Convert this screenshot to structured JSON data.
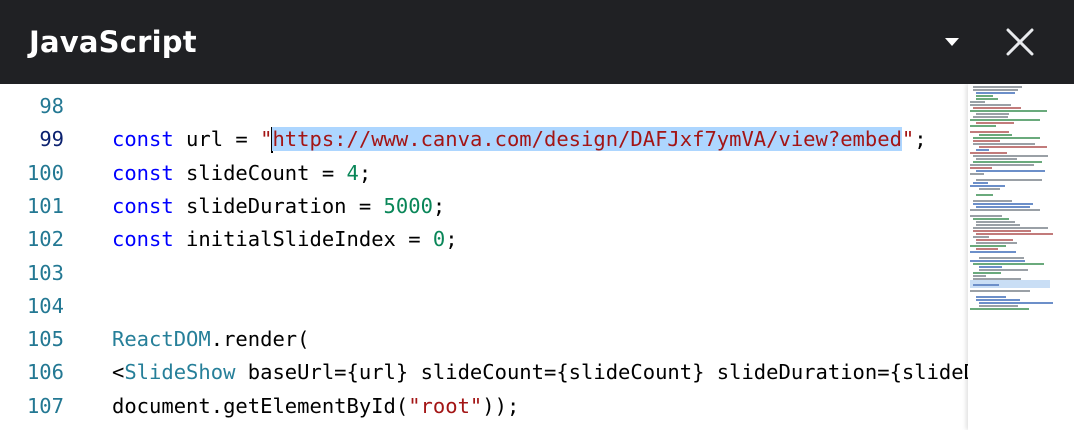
{
  "header": {
    "title": "JavaScript",
    "dropdown_icon": "caret-down-icon",
    "close_icon": "close-icon",
    "background": "#202124"
  },
  "editor": {
    "lines": [
      {
        "number": "98",
        "active": false,
        "tokens": []
      },
      {
        "number": "99",
        "active": true,
        "tokens": [
          {
            "t": "const",
            "c": "kw"
          },
          {
            "t": " url = ",
            "c": ""
          },
          {
            "t": "\"",
            "c": "str"
          },
          {
            "t": "https://www.canva.com/design/DAFJxf7ymVA/view?embed",
            "c": "str sel"
          },
          {
            "t": "\"",
            "c": "str"
          },
          {
            "t": ";",
            "c": ""
          }
        ]
      },
      {
        "number": "100",
        "active": false,
        "tokens": [
          {
            "t": "const",
            "c": "kw"
          },
          {
            "t": " slideCount = ",
            "c": ""
          },
          {
            "t": "4",
            "c": "numlit"
          },
          {
            "t": ";",
            "c": ""
          }
        ]
      },
      {
        "number": "101",
        "active": false,
        "tokens": [
          {
            "t": "const",
            "c": "kw"
          },
          {
            "t": " slideDuration = ",
            "c": ""
          },
          {
            "t": "5000",
            "c": "numlit"
          },
          {
            "t": ";",
            "c": ""
          }
        ]
      },
      {
        "number": "102",
        "active": false,
        "tokens": [
          {
            "t": "const",
            "c": "kw"
          },
          {
            "t": " initialSlideIndex = ",
            "c": ""
          },
          {
            "t": "0",
            "c": "numlit"
          },
          {
            "t": ";",
            "c": ""
          }
        ]
      },
      {
        "number": "103",
        "active": false,
        "tokens": []
      },
      {
        "number": "104",
        "active": false,
        "tokens": []
      },
      {
        "number": "105",
        "active": false,
        "tokens": [
          {
            "t": "ReactDOM",
            "c": "cls"
          },
          {
            "t": ".render(",
            "c": ""
          }
        ]
      },
      {
        "number": "106",
        "active": false,
        "tokens": [
          {
            "t": "<",
            "c": ""
          },
          {
            "t": "SlideShow",
            "c": "cls"
          },
          {
            "t": " baseUrl={url} slideCount={slideCount} slideDuration={slideDuration}",
            "c": ""
          }
        ]
      },
      {
        "number": "107",
        "active": false,
        "tokens": [
          {
            "t": "document.getElementById(",
            "c": ""
          },
          {
            "t": "\"root\"",
            "c": "str"
          },
          {
            "t": "));",
            "c": ""
          }
        ]
      }
    ],
    "colors": {
      "keyword": "#0000ff",
      "string": "#a31515",
      "number": "#098658",
      "type": "#267f99",
      "line_number": "#237893",
      "selection": "#add6ff"
    }
  }
}
